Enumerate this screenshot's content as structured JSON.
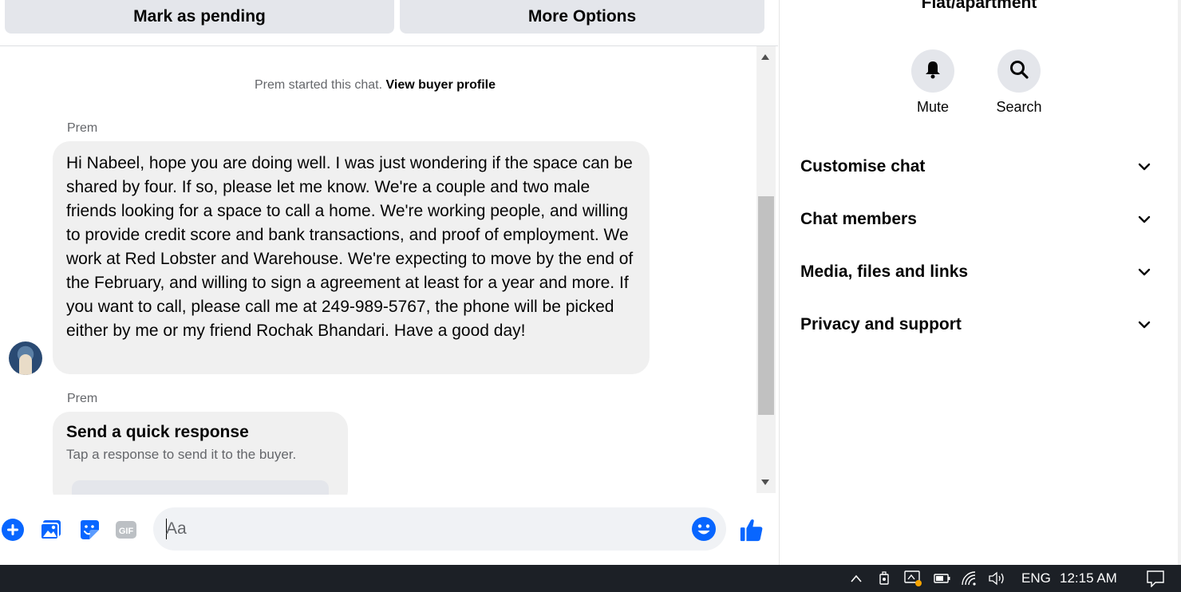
{
  "header": {
    "mark_pending_label": "Mark as pending",
    "more_options_label": "More Options"
  },
  "chat": {
    "system_text": "Prem started this chat.",
    "view_profile_link": "View buyer profile",
    "messages": [
      {
        "sender": "Prem",
        "text": "Hi Nabeel, hope you are doing well. I was just wondering if the space can be shared by four. If so, please let me know. We're a couple and two male friends looking for a space to call a home. We're working people, and willing to provide credit score and bank transactions, and proof of employment. We work at Red Lobster and Warehouse. We're expecting to move by the end of the February, and willing to sign a agreement at least for a year and more. If you want to call, please call me at 249-989-5767, the phone will be picked either by me or my friend Rochak Bhandari. Have a good day!"
      },
      {
        "sender": "Prem",
        "quick_title": "Send a quick response",
        "quick_sub": "Tap a response to send it to the buyer."
      }
    ]
  },
  "composer": {
    "placeholder": "Aa",
    "icons": [
      "plus-icon",
      "image-icon",
      "sticker-icon",
      "gif-icon",
      "emoji-icon",
      "thumbs-up-icon"
    ],
    "gif_label": "GIF"
  },
  "right_panel": {
    "title": "Flat/apartment",
    "actions": [
      {
        "label": "Mute",
        "icon": "bell-icon"
      },
      {
        "label": "Search",
        "icon": "search-icon"
      }
    ],
    "sections": [
      "Customise chat",
      "Chat members",
      "Media, files and links",
      "Privacy and support"
    ]
  },
  "taskbar": {
    "language": "ENG",
    "time": "12:15 AM"
  },
  "colors": {
    "accent": "#0866ff",
    "bubble": "#f0f0f0",
    "button": "#e4e6eb",
    "taskbar": "#1c2026"
  }
}
